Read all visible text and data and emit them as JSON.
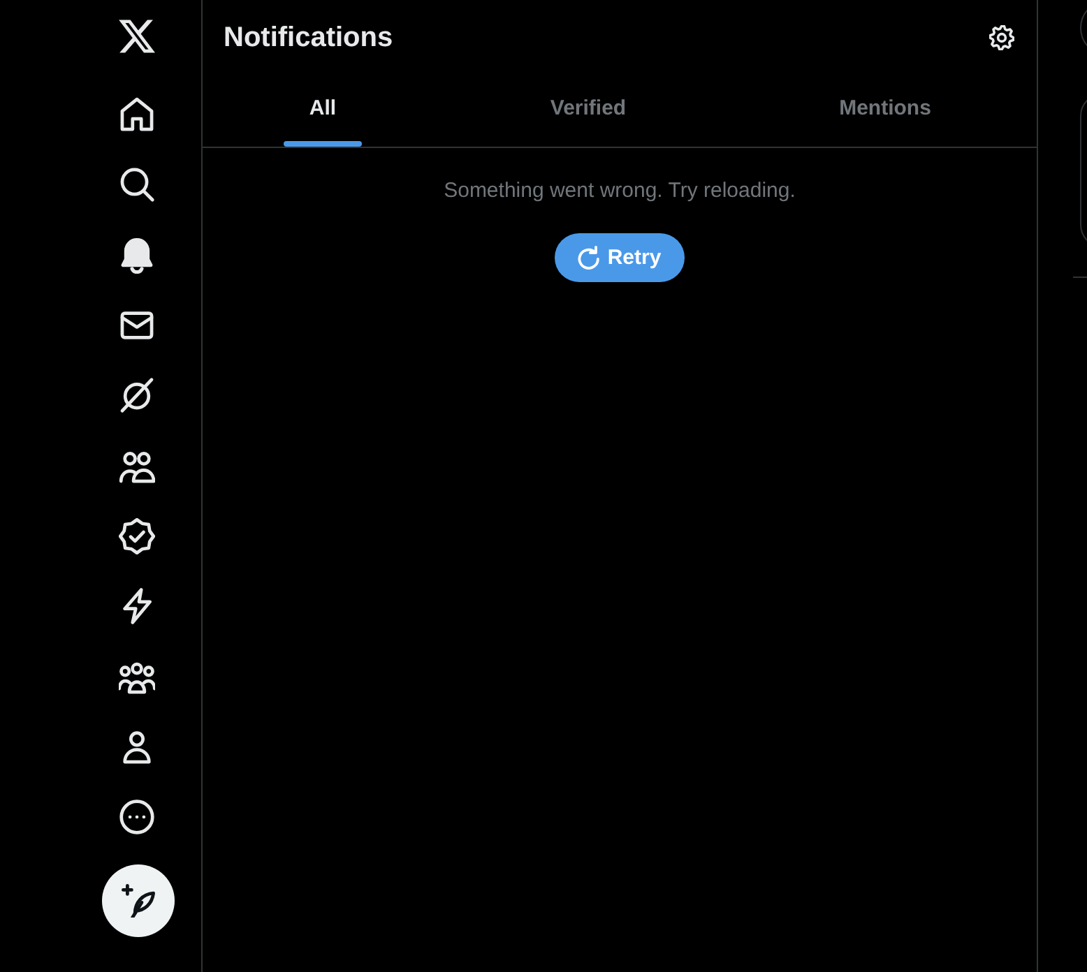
{
  "sidebar": {
    "nav_items": [
      {
        "selected": false
      },
      {
        "selected": false
      },
      {
        "selected": true
      },
      {
        "selected": false
      },
      {
        "selected": false
      },
      {
        "selected": false
      },
      {
        "selected": false
      },
      {
        "selected": false
      },
      {
        "selected": false
      },
      {
        "selected": false
      },
      {
        "selected": false
      }
    ]
  },
  "header": {
    "title": "Notifications"
  },
  "tabs": [
    {
      "label": "All",
      "selected": true
    },
    {
      "label": "Verified",
      "selected": false
    },
    {
      "label": "Mentions",
      "selected": false
    }
  ],
  "error": {
    "message": "Something went wrong. Try reloading.",
    "retry_button": "Retry"
  }
}
